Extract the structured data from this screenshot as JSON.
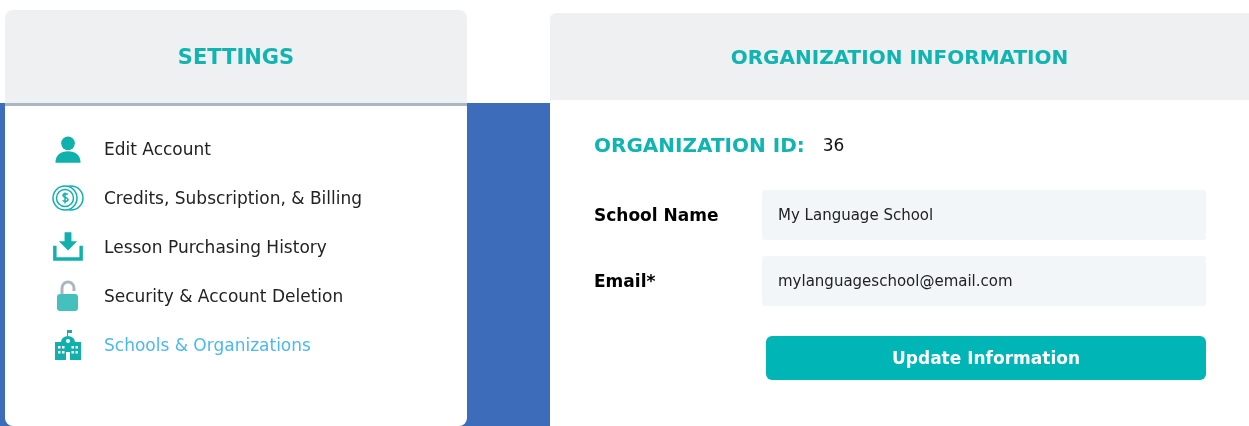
{
  "sidebar": {
    "title": "SETTINGS",
    "items": [
      {
        "label": "Edit Account",
        "kind": "person",
        "selected": false
      },
      {
        "label": "Credits, Subscription, & Billing",
        "kind": "coins",
        "selected": false
      },
      {
        "label": "Lesson Purchasing History",
        "kind": "download",
        "selected": false
      },
      {
        "label": "Security & Account Deletion",
        "kind": "lock",
        "selected": false
      },
      {
        "label": "Schools & Organizations",
        "kind": "school",
        "selected": true
      }
    ]
  },
  "panel": {
    "title": "ORGANIZATION INFORMATION",
    "id_label": "ORGANIZATION ID:",
    "id_value": "36",
    "fields": [
      {
        "label": "School Name",
        "value": "My Language School"
      },
      {
        "label": "Email*",
        "value": "mylanguageschool@email.com"
      }
    ],
    "button": "Update Information"
  }
}
